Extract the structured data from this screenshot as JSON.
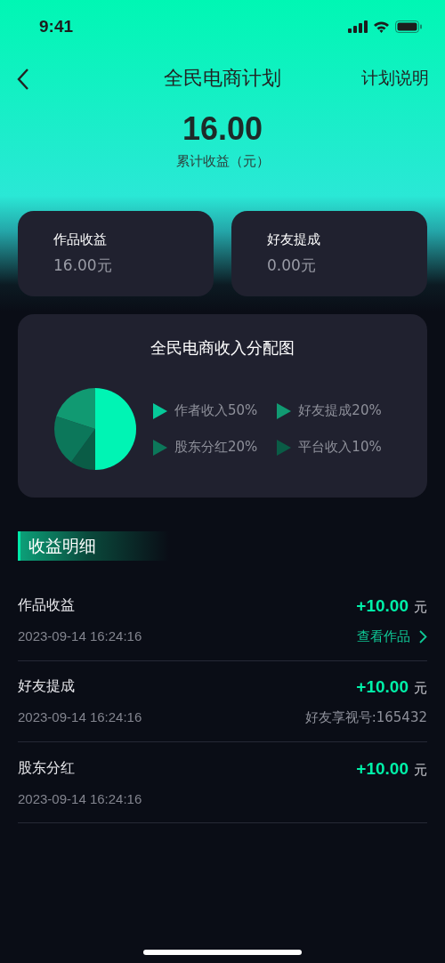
{
  "status_bar": {
    "time": "9:41"
  },
  "nav": {
    "title": "全民电商计划",
    "action": "计划说明"
  },
  "total": {
    "amount": "16.00",
    "label": "累计收益（元）"
  },
  "summary_cards": [
    {
      "label": "作品收益",
      "value": "16.00元"
    },
    {
      "label": "好友提成",
      "value": "0.00元"
    }
  ],
  "distribution": {
    "title": "全民电商收入分配图",
    "legend": [
      {
        "label": "作者收入50%",
        "color": "#00f4b4"
      },
      {
        "label": "好友提成20%",
        "color": "#119a72"
      },
      {
        "label": "股东分红20%",
        "color": "#0c775a"
      },
      {
        "label": "平台收入10%",
        "color": "#0a5c46"
      }
    ],
    "chart_data": {
      "type": "pie",
      "values": [
        50,
        20,
        20,
        10
      ]
    }
  },
  "details": {
    "title": "收益明细",
    "rows": [
      {
        "name": "作品收益",
        "amount": "+10.00",
        "unit": "元",
        "time": "2023-09-14 16:24:16",
        "extra": {
          "kind": "link",
          "text": "查看作品"
        }
      },
      {
        "name": "好友提成",
        "amount": "+10.00",
        "unit": "元",
        "time": "2023-09-14 16:24:16",
        "extra": {
          "kind": "text",
          "text": "好友享视号:165432"
        }
      },
      {
        "name": "股东分红",
        "amount": "+10.00",
        "unit": "元",
        "time": "2023-09-14 16:24:16"
      }
    ]
  }
}
